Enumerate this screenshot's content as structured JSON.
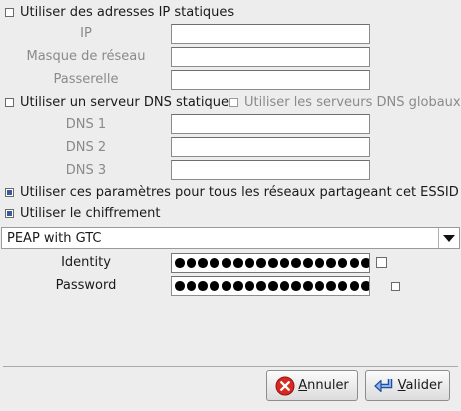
{
  "static_ip": {
    "label": "Utiliser des adresses IP statiques",
    "checked": false
  },
  "ip_fields": [
    {
      "label": "IP",
      "value": ""
    },
    {
      "label": "Masque de réseau",
      "value": ""
    },
    {
      "label": "Passerelle",
      "value": ""
    }
  ],
  "static_dns": {
    "label": "Utiliser un serveur DNS statique",
    "checked": false
  },
  "global_dns": {
    "label": "Utiliser les serveurs DNS globaux",
    "checked": false
  },
  "dns_fields": [
    {
      "label": "DNS 1",
      "value": ""
    },
    {
      "label": "DNS 2",
      "value": ""
    },
    {
      "label": "DNS 3",
      "value": ""
    }
  ],
  "shared_essid": {
    "label": "Utiliser ces paramètres pour tous les réseaux partageant cet ESSID",
    "checked": true
  },
  "encryption": {
    "label": "Utiliser le chiffrement",
    "checked": true
  },
  "encryption_method": {
    "selected": "PEAP with GTC"
  },
  "credentials": [
    {
      "label": "Identity",
      "masked_length": 19,
      "show_checked": false
    },
    {
      "label": "Password",
      "masked_length": 19,
      "show_checked": false
    }
  ],
  "buttons": {
    "cancel_prefix": "A",
    "cancel_rest": "nnuler",
    "ok_prefix": "V",
    "ok_rest": "alider"
  }
}
